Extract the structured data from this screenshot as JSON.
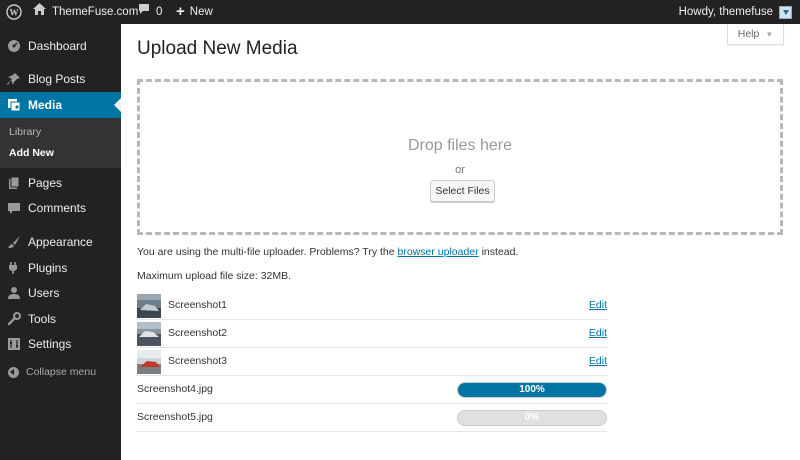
{
  "adminbar": {
    "site_name": "ThemeFuse.com",
    "comment_count": "0",
    "new_label": "New",
    "howdy": "Howdy, themefuse"
  },
  "sidebar": {
    "items": [
      {
        "label": "Dashboard",
        "icon": "dashboard-icon"
      },
      {
        "label": "Blog Posts",
        "icon": "pin-icon"
      },
      {
        "label": "Media",
        "icon": "media-icon"
      },
      {
        "label": "Pages",
        "icon": "pages-icon"
      },
      {
        "label": "Comments",
        "icon": "comment-icon"
      },
      {
        "label": "Appearance",
        "icon": "brush-icon"
      },
      {
        "label": "Plugins",
        "icon": "plugin-icon"
      },
      {
        "label": "Users",
        "icon": "user-icon"
      },
      {
        "label": "Tools",
        "icon": "wrench-icon"
      },
      {
        "label": "Settings",
        "icon": "settings-icon"
      }
    ],
    "submenu": [
      "Library",
      "Add New"
    ],
    "collapse_label": "Collapse menu"
  },
  "main": {
    "help_label": "Help",
    "title": "Upload New Media",
    "drop_title": "Drop files here",
    "drop_or": "or",
    "select_files": "Select Files",
    "info_prefix": "You are using the multi-file uploader. Problems? Try the",
    "info_link": "browser uploader",
    "info_suffix": "instead.",
    "max_size": "Maximum upload file size: 32MB.",
    "edit_label": "Edit",
    "uploaded": [
      {
        "name": "Screenshot1"
      },
      {
        "name": "Screenshot2"
      },
      {
        "name": "Screenshot3"
      }
    ],
    "uploading": [
      {
        "name": "Screenshot4.jpg",
        "progress_label": "100%",
        "progress": 1.0
      },
      {
        "name": "Screenshot5.jpg",
        "progress_label": "0%",
        "progress": 0.0
      }
    ]
  },
  "colors": {
    "accent": "#0074a2",
    "adminbar": "#222222"
  }
}
